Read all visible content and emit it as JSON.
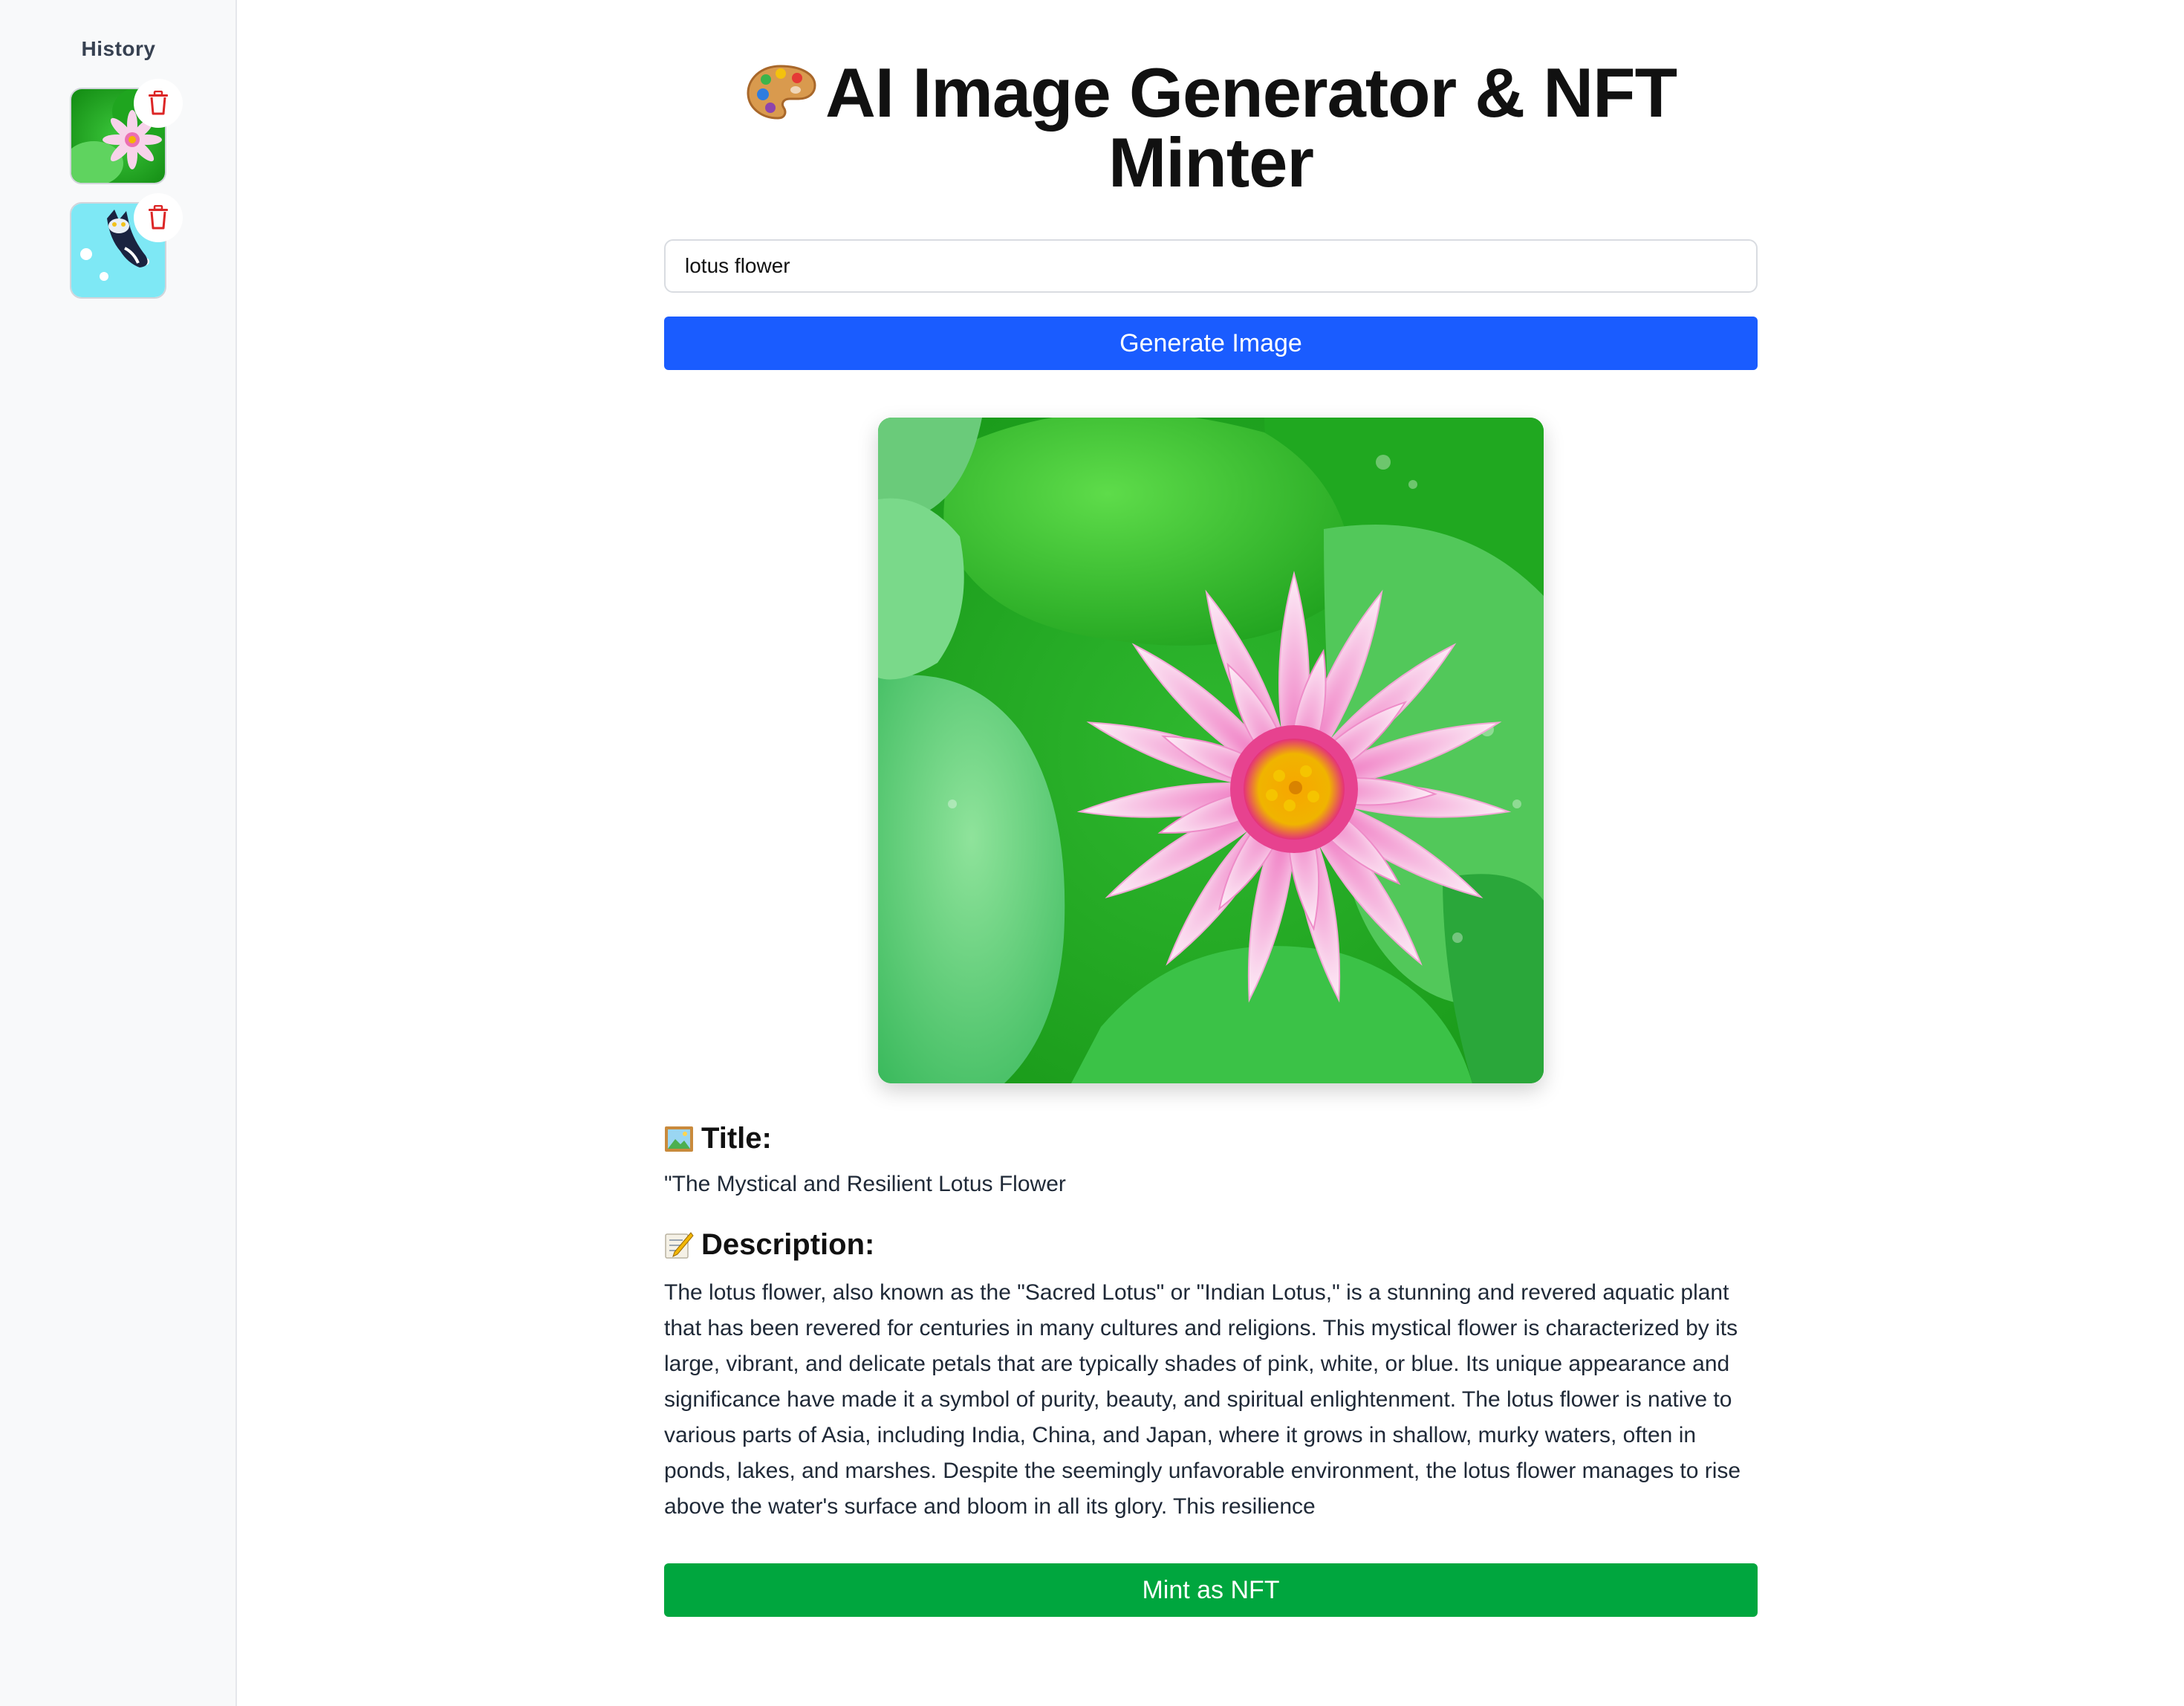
{
  "sidebar": {
    "title": "History",
    "items": [
      {
        "thumb": "lotus-flower-thumbnail",
        "delete_icon": "trash-icon"
      },
      {
        "thumb": "cartoon-cat-thumbnail",
        "delete_icon": "trash-icon"
      }
    ]
  },
  "header": {
    "icon": "palette-icon",
    "title": "AI Image Generator & NFT Minter"
  },
  "prompt": {
    "value": "lotus flower"
  },
  "generate_button": {
    "label": "Generate Image"
  },
  "result": {
    "image": "generated-lotus-image",
    "title_heading": "Title:",
    "title_icon": "framed-picture-icon",
    "title": "\"The Mystical and Resilient Lotus Flower",
    "description_heading": "Description:",
    "description_icon": "memo-icon",
    "description": "The lotus flower, also known as the \"Sacred Lotus\" or \"Indian Lotus,\" is a stunning and revered aquatic plant that has been revered for centuries in many cultures and religions. This mystical flower is characterized by its large, vibrant, and delicate petals that are typically shades of pink, white, or blue. Its unique appearance and significance have made it a symbol of purity, beauty, and spiritual enlightenment. The lotus flower is native to various parts of Asia, including India, China, and Japan, where it grows in shallow, murky waters, often in ponds, lakes, and marshes. Despite the seemingly unfavorable environment, the lotus flower manages to rise above the water's surface and bloom in all its glory. This resilience"
  },
  "mint_button": {
    "label": "Mint as NFT"
  },
  "colors": {
    "primary": "#1a5cff",
    "mint": "#00a63e",
    "delete": "#dc2626",
    "sidebar_bg": "#f8f9fa"
  }
}
